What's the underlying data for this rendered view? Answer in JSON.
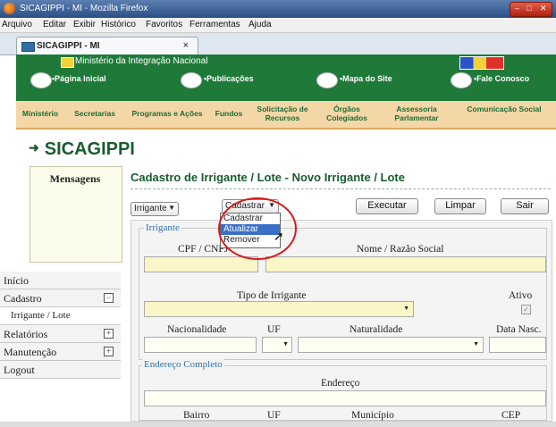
{
  "window": {
    "title": "SICAGIPPI - MI - Mozilla Firefox"
  },
  "menubar": [
    "Arquivo",
    "Editar",
    "Exibir",
    "Histórico",
    "Favoritos",
    "Ferramentas",
    "Ajuda"
  ],
  "tab": {
    "title": "SICAGIPPI - MI",
    "close": "×"
  },
  "site_header": {
    "ministry": "Ministério da Integração Nacional",
    "nav": [
      "•Página Inicial",
      "•Publicações",
      "•Mapa do Site",
      "•Fale Conosco"
    ]
  },
  "main_menu": [
    "Ministério",
    "Secretarias",
    "Programas e Ações",
    "Fundos",
    "Solicitação de Recursos",
    "Órgãos Colegiados",
    "Assessoria Parlamentar",
    "Comunicação Social"
  ],
  "brand": "SICAGIPPI",
  "sidebar": {
    "messages_title": "Mensagens",
    "items": [
      {
        "label": "Início",
        "toggle": ""
      },
      {
        "label": "Cadastro",
        "toggle": "⊟"
      },
      {
        "label": "Irrigante / Lote",
        "toggle": ""
      },
      {
        "label": "Relatórios",
        "toggle": "⊞"
      },
      {
        "label": "Manutenção",
        "toggle": "⊞"
      },
      {
        "label": "Logout",
        "toggle": ""
      }
    ]
  },
  "page": {
    "title": "Cadastro de Irrigante / Lote - Novo Irrigante / Lote",
    "entity_select": "Irrigante",
    "action_select": "Cadastrar",
    "action_options": [
      "Cadastrar",
      "Atualizar",
      "Remover"
    ],
    "highlighted_option": "Atualizar",
    "buttons": {
      "execute": "Executar",
      "clear": "Limpar",
      "exit": "Sair"
    }
  },
  "form": {
    "irrigante_legend": "Irrigante",
    "cpf_label": "CPF / CNPJ",
    "name_label": "Nome / Razão Social",
    "type_label": "Tipo de Irrigante",
    "active_label": "Ativo",
    "active_checked": "✓",
    "nationality_label": "Nacionalidade",
    "uf_label": "UF",
    "naturality_label": "Naturalidade",
    "birthdate_label": "Data Nasc.",
    "address_legend": "Endereço Completo",
    "address_label": "Endereço",
    "district_label": "Bairro",
    "uf2_label": "UF",
    "city_label": "Município",
    "zip_label": "CEP"
  },
  "colors": {
    "header_green": "#1f7a3a",
    "menu_orange": "#f3d7a6",
    "title_green": "#1a5c2f",
    "highlight_blue": "#3a6fc6",
    "annotation_red": "#d81b1b"
  }
}
